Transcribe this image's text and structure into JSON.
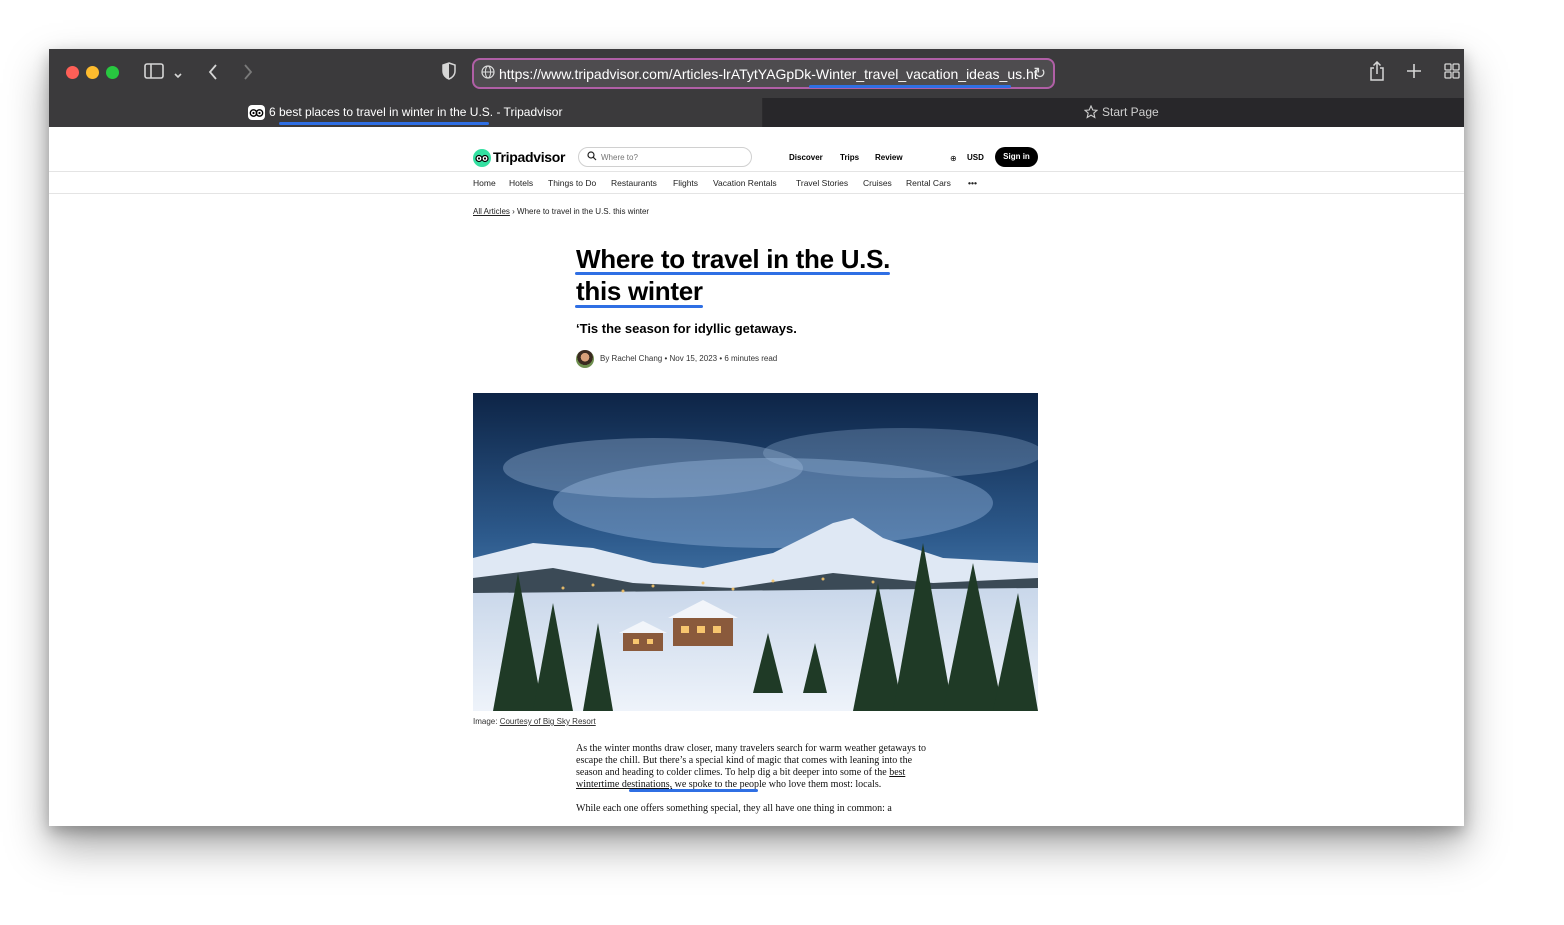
{
  "browser": {
    "url": "https://www.tripadvisor.com/Articles-lrATytYAGpDk-Winter_travel_vacation_ideas_us.ht",
    "tabs": [
      {
        "title": "6 best places to travel in winter in the U.S. - Tripadvisor",
        "active": true
      },
      {
        "title": "Start Page",
        "active": false
      }
    ],
    "colors": {
      "toolbar": "#3b3a3c",
      "url_highlight": "#b05fa6",
      "underline": "#2f6fe4"
    }
  },
  "site": {
    "brand": "Tripadvisor",
    "search_placeholder": "Where to?",
    "top_links": [
      "Discover",
      "Trips",
      "Review"
    ],
    "currency": "USD",
    "signin_label": "Sign in",
    "categories": [
      "Home",
      "Hotels",
      "Things to Do",
      "Restaurants",
      "Flights",
      "Vacation Rentals",
      "Travel Stories",
      "Cruises",
      "Rental Cars"
    ],
    "more_label": "•••",
    "brand_color": "#34e0a1"
  },
  "article": {
    "breadcrumb_root": "All Articles",
    "breadcrumb_sep": "›",
    "breadcrumb_current": "Where to travel in the U.S. this winter",
    "title_line1": "Where to travel in the U.S.",
    "title_line2": "this winter",
    "subtitle": "‘Tis the season for idyllic getaways.",
    "byline": "By Rachel Chang • Nov 15, 2023 • 6 minutes read",
    "caption_prefix": "Image: ",
    "caption_link": "Courtesy of Big Sky Resort",
    "para1_start": "As the winter months draw closer, many travelers search for warm weather getaways to escape the chill. But there’s a special kind of magic that comes with leaning into the season and heading to colder climes. To help dig a bit deeper into some of the ",
    "para1_link": "best wintertime destinations,",
    "para1_end": " we spoke to the people who love them most: locals.",
    "para2": "While each one offers something special, they all have one thing in common: a"
  }
}
